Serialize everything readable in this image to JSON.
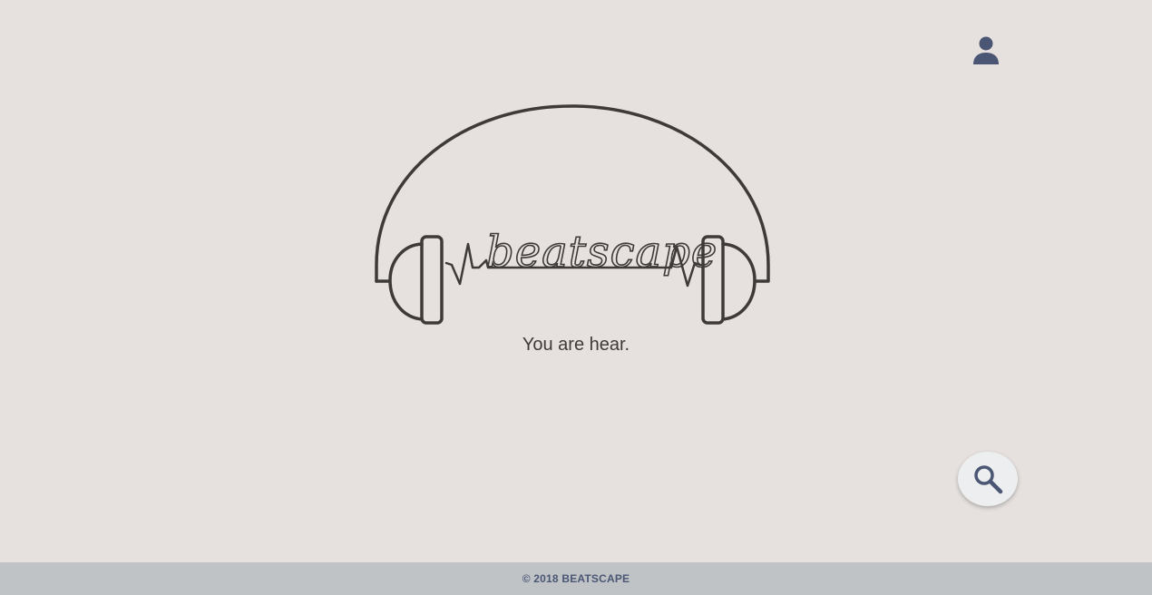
{
  "header": {
    "user_icon": "user-icon"
  },
  "brand": {
    "name": "beatscape",
    "tagline": "You are hear.",
    "logo_icon": "headphones-icon"
  },
  "search": {
    "icon": "search-icon"
  },
  "footer": {
    "copyright": "© 2018 BEATSCAPE"
  },
  "colors": {
    "background": "#e6e1de",
    "ink": "#3e3a37",
    "accent": "#4a5674",
    "footer_bg": "#bfc3c6",
    "fab_bg": "#edeeef"
  }
}
